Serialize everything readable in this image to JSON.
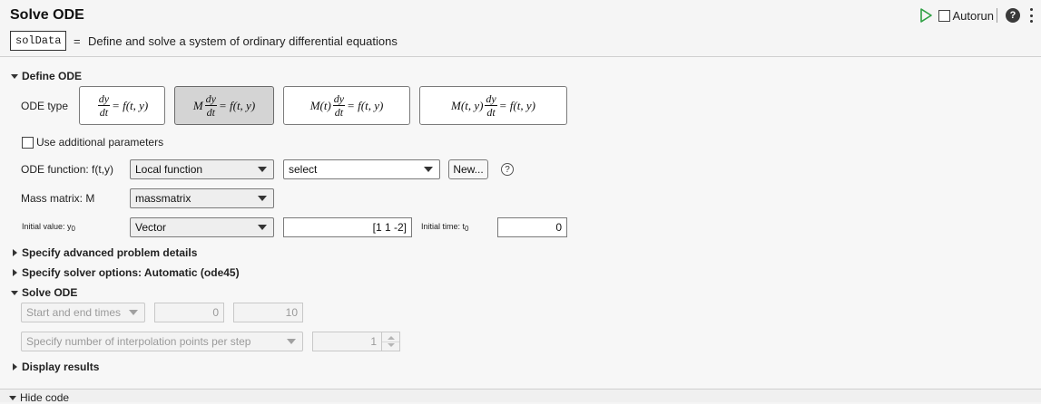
{
  "header": {
    "title": "Solve ODE",
    "output_var": "solData",
    "equals": "=",
    "description": "Define and solve a system of ordinary differential equations",
    "autorun_label": "Autorun",
    "help": "?"
  },
  "define_ode": {
    "section_label": "Define ODE",
    "ode_type_label": "ODE type",
    "ode_types": [
      {
        "prefix": "",
        "num": "dy",
        "den": "dt",
        "rest": "= f(t, y)",
        "selected": false
      },
      {
        "prefix": "M",
        "num": "dy",
        "den": "dt",
        "rest": "= f(t, y)",
        "selected": true
      },
      {
        "prefix": "M(t)",
        "num": "dy",
        "den": "dt",
        "rest": "= f(t, y)",
        "selected": false
      },
      {
        "prefix": "M(t, y)",
        "num": "dy",
        "den": "dt",
        "rest": "= f(t, y)",
        "selected": false
      }
    ],
    "use_params_label": "Use additional parameters",
    "ode_function_label": "ODE function: f(t,y)",
    "ode_function_source": "Local function",
    "ode_function_select": "select",
    "new_button": "New...",
    "help_q": "?",
    "mass_matrix_label": "Mass matrix: M",
    "mass_matrix_value": "massmatrix",
    "initial_value_label": "Initial value: y",
    "initial_value_sub": "0",
    "initial_value_type": "Vector",
    "initial_value_text": "[1 1 -2]",
    "initial_time_label": "Initial time: t",
    "initial_time_sub": "0",
    "initial_time_value": "0"
  },
  "advanced_label": "Specify advanced problem details",
  "solver_label": "Specify solver options: Automatic (ode45)",
  "solve": {
    "section_label": "Solve ODE",
    "time_mode": "Start and end times",
    "start_time": "0",
    "end_time": "10",
    "interp_mode": "Specify number of interpolation points per step",
    "interp_points": "1"
  },
  "display_label": "Display results",
  "footer": {
    "hide_code": "Hide code"
  },
  "colors": {
    "run_green": "#2ea043",
    "selected_bg": "#d4d4d4"
  }
}
